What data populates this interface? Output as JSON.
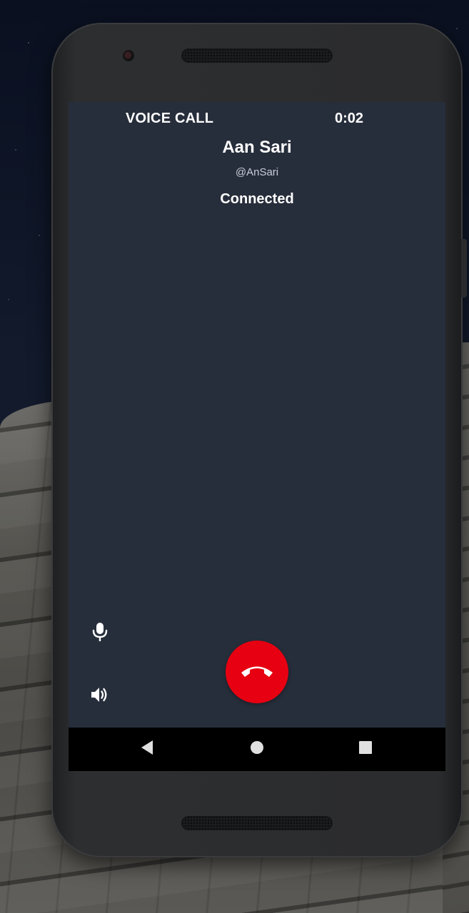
{
  "call": {
    "type_label": "VOICE CALL",
    "timer": "0:02",
    "caller_name": "Aan Sari",
    "caller_handle": "@AnSari",
    "status": "Connected"
  },
  "controls": {
    "mic_icon": "microphone-icon",
    "speaker_icon": "speaker-volume-icon",
    "hangup_icon": "phone-hangup-icon"
  },
  "navbar": {
    "back_icon": "back-triangle-icon",
    "home_icon": "home-circle-icon",
    "recents_icon": "recents-square-icon"
  },
  "colors": {
    "screen_background": "#272e3b",
    "hangup_red": "#e60012",
    "text": "#ffffff",
    "navbar": "#000000"
  }
}
